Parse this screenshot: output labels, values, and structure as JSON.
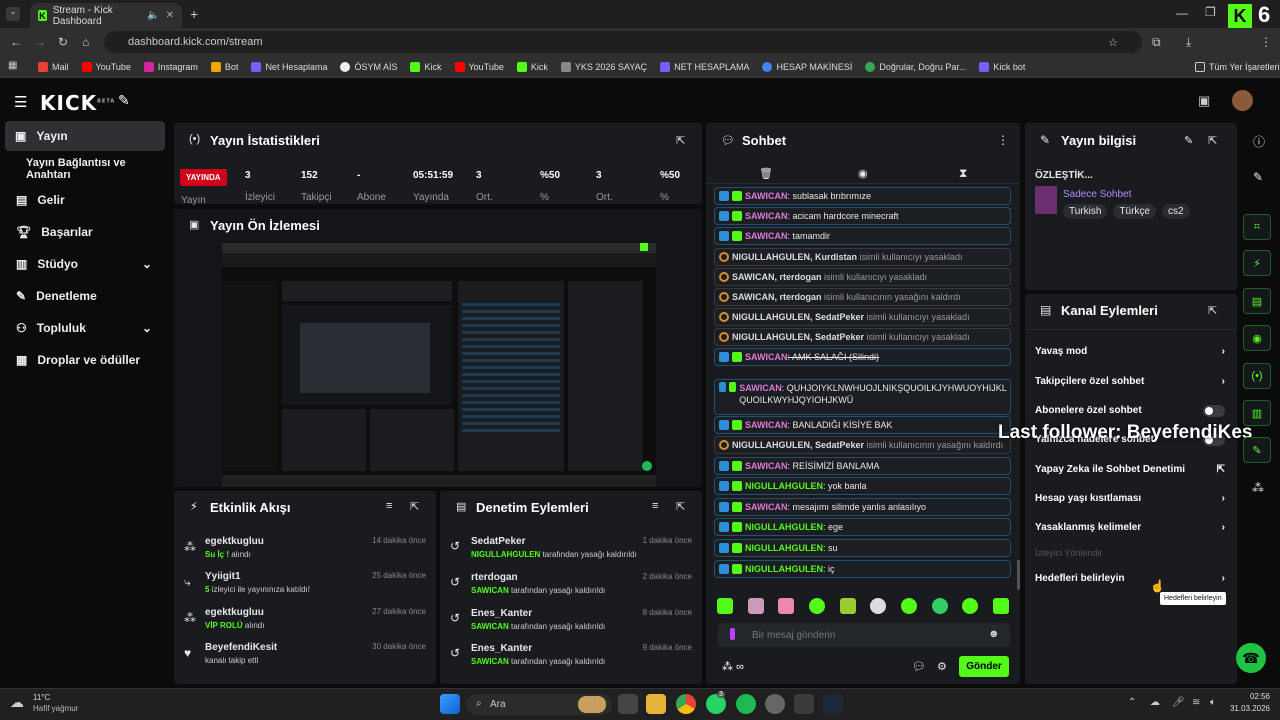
{
  "browser": {
    "tab_title": "Stream - Kick Dashboard",
    "url": "dashboard.kick.com/stream",
    "all_bookmarks": "Tüm Yer İşaretleri",
    "bookmarks": [
      "Mail",
      "YouTube",
      "Instagram",
      "Bot",
      "Net Hesaplama",
      "ÖSYM AİS",
      "Kick",
      "YouTube",
      "Kick",
      "YKS 2026 SAYAÇ",
      "NET HESAPLAMA",
      "HESAP MAKİNESİ",
      "Doğrular, Doğru Par...",
      "Kick bot"
    ]
  },
  "header": {
    "logo": "KICK",
    "beta": "BETA"
  },
  "overlay": {
    "k_count": "6",
    "last_follower": "Last follower: BeyefendiKes"
  },
  "sidebar": {
    "items": [
      {
        "label": "Yayın"
      },
      {
        "label": "Yayın Bağlantısı ve Anahtarı"
      },
      {
        "label": "Gelir"
      },
      {
        "label": "Başarılar"
      },
      {
        "label": "Stüdyo"
      },
      {
        "label": "Denetleme"
      },
      {
        "label": "Topluluk"
      },
      {
        "label": "Droplar ve ödüller"
      }
    ]
  },
  "stats": {
    "title": "Yayın İstatistikleri",
    "live_badge": "YAYINDA",
    "live_label": "Yayın",
    "items": [
      {
        "value": "3",
        "label": "İzleyici"
      },
      {
        "value": "152",
        "label": "Takipçi"
      },
      {
        "value": "-",
        "label": "Abone"
      },
      {
        "value": "05:51:59",
        "label": "Yayında"
      },
      {
        "value": "3",
        "label": "Ort."
      },
      {
        "value": "%50",
        "label": "%"
      },
      {
        "value": "3",
        "label": "Ort."
      },
      {
        "value": "%50",
        "label": "%"
      }
    ]
  },
  "preview": {
    "title": "Yayın Ön İzlemesi"
  },
  "activity": {
    "title": "Etkinlik Akışı",
    "items": [
      {
        "name": "egektkugluu",
        "time": "14 dakika önce",
        "hl": "Su İç !",
        "rest": " alındı"
      },
      {
        "name": "Yyiigit1",
        "time": "25 dakika önce",
        "hl": "5",
        "rest": " izleyici ile yayınınıza katıldı!"
      },
      {
        "name": "egektkugluu",
        "time": "27 dakika önce",
        "hl": "VİP ROLÜ",
        "rest": " alındı"
      },
      {
        "name": "BeyefendiKesit",
        "time": "30 dakika önce",
        "hl": "",
        "rest": "kanalı takip etti"
      }
    ]
  },
  "modlog": {
    "title": "Denetim Eylemleri",
    "items": [
      {
        "name": "SedatPeker",
        "time": "1 dakika önce",
        "hl": "NIGULLAHGULEN",
        "rest": " tarafından yasağı kaldırıldı"
      },
      {
        "name": "rterdogan",
        "time": "2 dakika önce",
        "hl": "SAWICAN",
        "rest": " tarafından yasağı kaldırıldı"
      },
      {
        "name": "Enes_Kanter",
        "time": "8 dakika önce",
        "hl": "SAWICAN",
        "rest": " tarafından yasağı kaldırıldı"
      },
      {
        "name": "Enes_Kanter",
        "time": "9 dakika önce",
        "hl": "SAWICAN",
        "rest": " tarafından yasağı kaldırıldı"
      }
    ]
  },
  "chat": {
    "title": "Sohbet",
    "placeholder": "Bir mesaj gönderin",
    "send": "Gönder",
    "messages": [
      {
        "u": "SAWICAN",
        "m": ": sublasak brıbrımıze",
        "c": "mag",
        "k": "user"
      },
      {
        "u": "SAWICAN",
        "m": ": acicam hardcore minecraft",
        "c": "mag",
        "k": "user"
      },
      {
        "u": "SAWICAN",
        "m": ": tamamdir",
        "c": "mag",
        "k": "user"
      },
      {
        "u": "NIGULLAHGULEN, Kurdistan",
        "m": " isimli kullanıcıyı yasakladı",
        "c": "",
        "k": "mod"
      },
      {
        "u": "SAWICAN, rterdogan",
        "m": " isimli kullanıcıyı yasakladı",
        "c": "",
        "k": "mod"
      },
      {
        "u": "SAWICAN, rterdogan",
        "m": " isimli kullanıcının yasağını kaldırdı",
        "c": "",
        "k": "mod"
      },
      {
        "u": "NIGULLAHGULEN, SedatPeker",
        "m": " isimli kullanıcıyı yasakladı",
        "c": "",
        "k": "mod"
      },
      {
        "u": "NIGULLAHGULEN, SedatPeker",
        "m": " isimli kullanıcıyı yasakladı",
        "c": "",
        "k": "mod"
      },
      {
        "u": "SAWICAN",
        "m": ": AMK SALAĞI (Silindi)",
        "c": "mag",
        "k": "user"
      },
      {
        "u": "SAWICAN",
        "m": ": QUHJOIYKLNWHUOJLNIKŞQUOILKJYHWUOYHIJKLQUOILKWYHJQYIOHJKWÜ",
        "c": "mag",
        "k": "user"
      },
      {
        "u": "SAWICAN",
        "m": ": BANLADIĞI KİSİYE BAK",
        "c": "mag",
        "k": "user"
      },
      {
        "u": "NIGULLAHGULEN, SedatPeker",
        "m": " isimli kullanıcının yasağını kaldırdı",
        "c": "",
        "k": "mod"
      },
      {
        "u": "SAWICAN",
        "m": ": REİSİMİZİ BANLAMA",
        "c": "mag",
        "k": "user"
      },
      {
        "u": "NIGULLAHGULEN",
        "m": ": yok banla",
        "c": "grn",
        "k": "user"
      },
      {
        "u": "SAWICAN",
        "m": ": mesajımı silimde yanlıs anlasılıyo",
        "c": "mag",
        "k": "user"
      },
      {
        "u": "NIGULLAHGULEN",
        "m": ": ege",
        "c": "grn",
        "k": "user"
      },
      {
        "u": "NIGULLAHGULEN",
        "m": ": su",
        "c": "grn",
        "k": "user"
      },
      {
        "u": "NIGULLAHGULEN",
        "m": ": iç",
        "c": "grn",
        "k": "user"
      }
    ]
  },
  "info": {
    "title": "Yayın bilgisi",
    "stream_title": "ÖZLEŞTİK...",
    "category": "Sadece Sohbet",
    "tags": [
      "Turkish",
      "Türkçe",
      "cs2"
    ]
  },
  "channel_actions": {
    "title": "Kanal Eylemleri",
    "items": [
      "Yavaş mod",
      "Takipçilere özel sohbet",
      "Abonelere özel sohbet",
      "Yalnızca hadelere sohbet",
      "Yapay Zeka ile Sohbet Denetimi",
      "Hesap yaşı kısıtlaması",
      "Yasaklanmış kelimeler",
      "İzleyici Yönlendir",
      "Hedefleri belirleyin"
    ],
    "tooltip": "Hedefleri belirleyin"
  },
  "taskbar": {
    "temp": "11°C",
    "weather": "Hafif yağmur",
    "search": "Ara",
    "time": "02:56",
    "date": "31.03.2026",
    "badge": "3"
  },
  "colors": {
    "accent": "#53fc18",
    "live": "#d0021b",
    "mention": "#e07ad8"
  }
}
